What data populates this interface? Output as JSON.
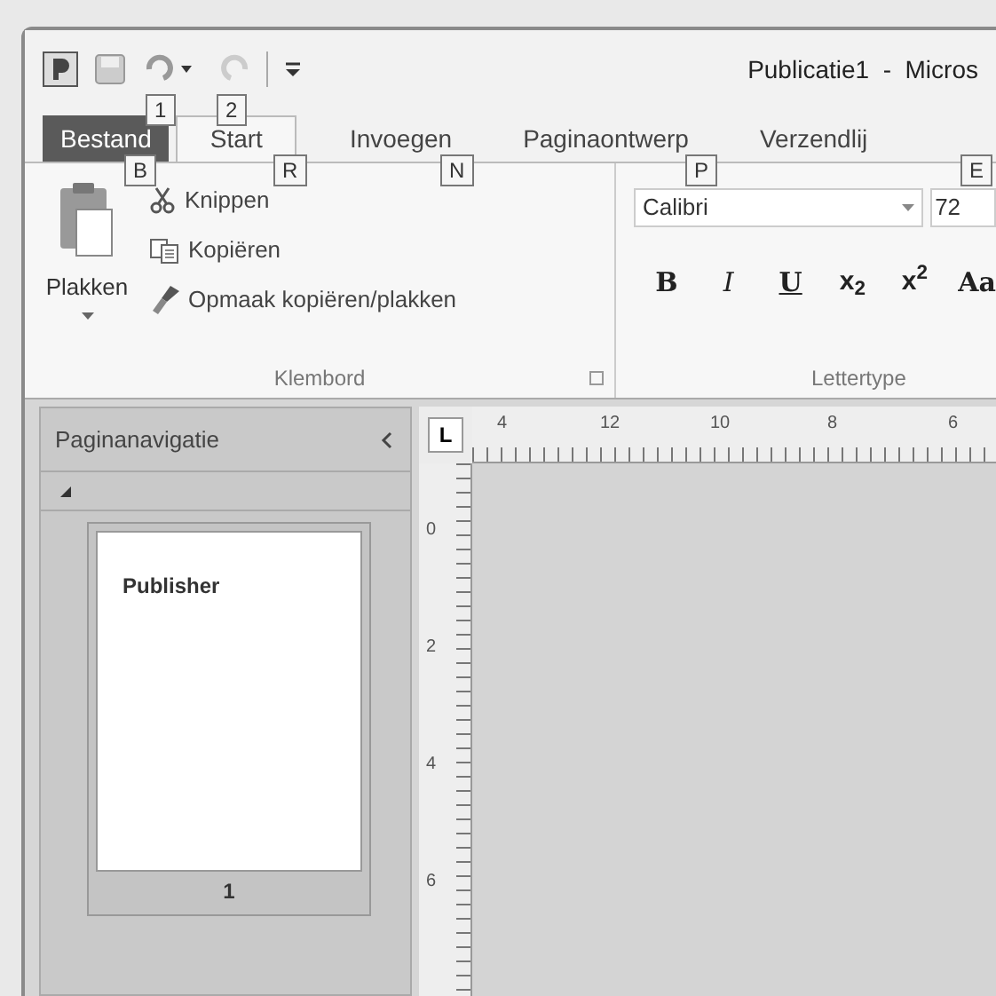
{
  "window": {
    "title": "Publicatie1  -  Micros"
  },
  "quick_access": {
    "keytips": [
      "1",
      "2"
    ]
  },
  "tabs": [
    {
      "label": "Bestand",
      "kind": "file",
      "selected": false,
      "keytip": "B"
    },
    {
      "label": "Start",
      "kind": "tab",
      "selected": true,
      "keytip": "R"
    },
    {
      "label": "Invoegen",
      "kind": "tab",
      "selected": false,
      "keytip": "N"
    },
    {
      "label": "Paginaontwerp",
      "kind": "tab",
      "selected": false,
      "keytip": "P"
    },
    {
      "label": "Verzendlij",
      "kind": "tab",
      "selected": false,
      "keytip": "E"
    }
  ],
  "clipboard": {
    "paste": "Plakken",
    "items": [
      {
        "label": "Knippen",
        "kind": "cut"
      },
      {
        "label": "Kopiëren",
        "kind": "copy"
      },
      {
        "label": "Opmaak kopiëren/plakken",
        "kind": "format"
      }
    ],
    "group_label": "Klembord"
  },
  "font": {
    "family": "Calibri",
    "size": "72",
    "buttons": [
      {
        "label": "B",
        "kind": "bold"
      },
      {
        "label": "I",
        "kind": "italic"
      },
      {
        "label": "U",
        "kind": "underline"
      },
      {
        "label": "x$_{2}$",
        "kind": "sub"
      },
      {
        "label": "x$^{2}$",
        "kind": "sup"
      },
      {
        "label": "Aa",
        "kind": "case"
      }
    ],
    "group_label": "Lettertype"
  },
  "nav_pane": {
    "title": "Paginanavigatie",
    "expanded": true,
    "pages": [
      {
        "text": "Publisher",
        "number": "1",
        "selected": false
      }
    ]
  },
  "ruler": {
    "corner": "L",
    "horizontal": [
      "4",
      "12",
      "10",
      "8",
      "6"
    ],
    "vertical": [
      "0",
      "2",
      "4",
      "6"
    ]
  }
}
